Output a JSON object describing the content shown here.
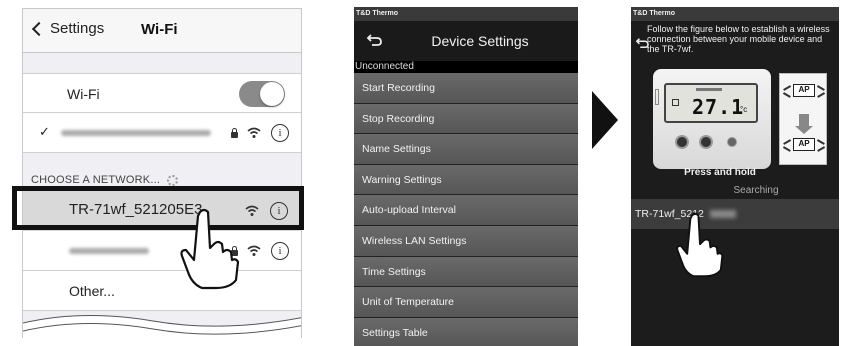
{
  "panel1": {
    "back_label": "Settings",
    "title": "Wi-Fi",
    "wifi_label": "Wi-Fi",
    "wifi_on": true,
    "choose_header": "CHOOSE A NETWORK...",
    "selected_network": "TR-71wf_521205E3",
    "other_label": "Other..."
  },
  "panel2": {
    "status_bar": "T&D Thermo",
    "title": "Device Settings",
    "status": "Unconnected",
    "menu": [
      "Start Recording",
      "Stop Recording",
      "Name Settings",
      "Warning Settings",
      "Auto-upload Interval",
      "Wireless LAN Settings",
      "Time Settings",
      "Unit of Temperature",
      "Settings Table"
    ]
  },
  "panel3": {
    "status_bar": "T&D Thermo",
    "instruction": "Follow the figure below to establish a wireless connection between your mobile device and the TR-7wf.",
    "lcd_value": "27.1",
    "lcd_unit": "°c",
    "ap_label": "AP",
    "press_hold": "Press and hold",
    "searching": "Searching",
    "network_row": "TR-71wf_5212"
  },
  "colors": {
    "highlight_border": "#111111",
    "app_header": "#1a1a1a",
    "menu_item": "#5e5e5e"
  }
}
